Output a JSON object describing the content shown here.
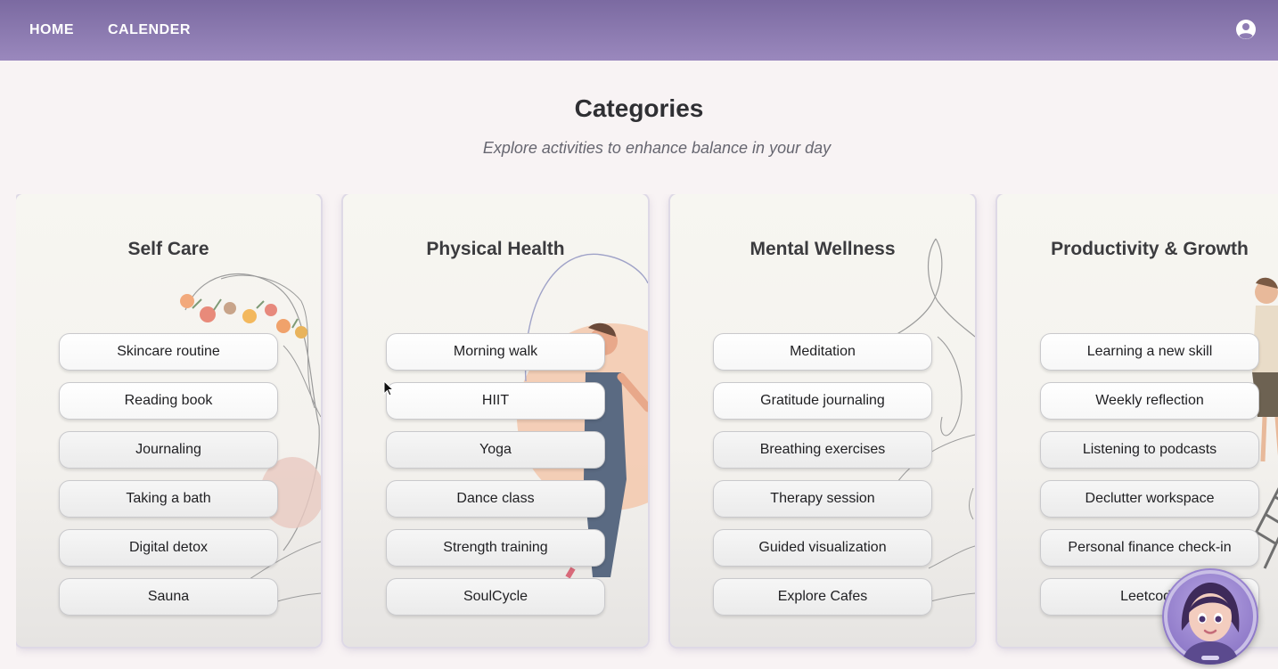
{
  "nav": {
    "links": [
      "HOME",
      "CALENDER"
    ],
    "profile_icon": "account-circle-icon"
  },
  "page": {
    "title": "Categories",
    "subtitle": "Explore activities to enhance balance in your day"
  },
  "categories": [
    {
      "title": "Self Care",
      "activities": [
        "Skincare routine",
        "Reading book",
        "Journaling",
        "Taking a bath",
        "Digital detox",
        "Sauna"
      ]
    },
    {
      "title": "Physical Health",
      "activities": [
        "Morning walk",
        "HIIT",
        "Yoga",
        "Dance class",
        "Strength training",
        "SoulCycle"
      ]
    },
    {
      "title": "Mental Wellness",
      "activities": [
        "Meditation",
        "Gratitude journaling",
        "Breathing exercises",
        "Therapy session",
        "Guided visualization",
        "Explore Cafes"
      ]
    },
    {
      "title": "Productivity & Growth",
      "activities": [
        "Learning a new skill",
        "Weekly reflection",
        "Listening to podcasts",
        "Declutter workspace",
        "Personal finance check-in",
        "Leetcode"
      ]
    }
  ],
  "colors": {
    "nav_top": "#7b6aa1",
    "nav_bottom": "#9a88bd",
    "page_background": "#f8f3f4",
    "avatar_ring": "#8e79c8"
  },
  "assistant": {
    "icon": "ai-assistant-avatar-icon"
  }
}
